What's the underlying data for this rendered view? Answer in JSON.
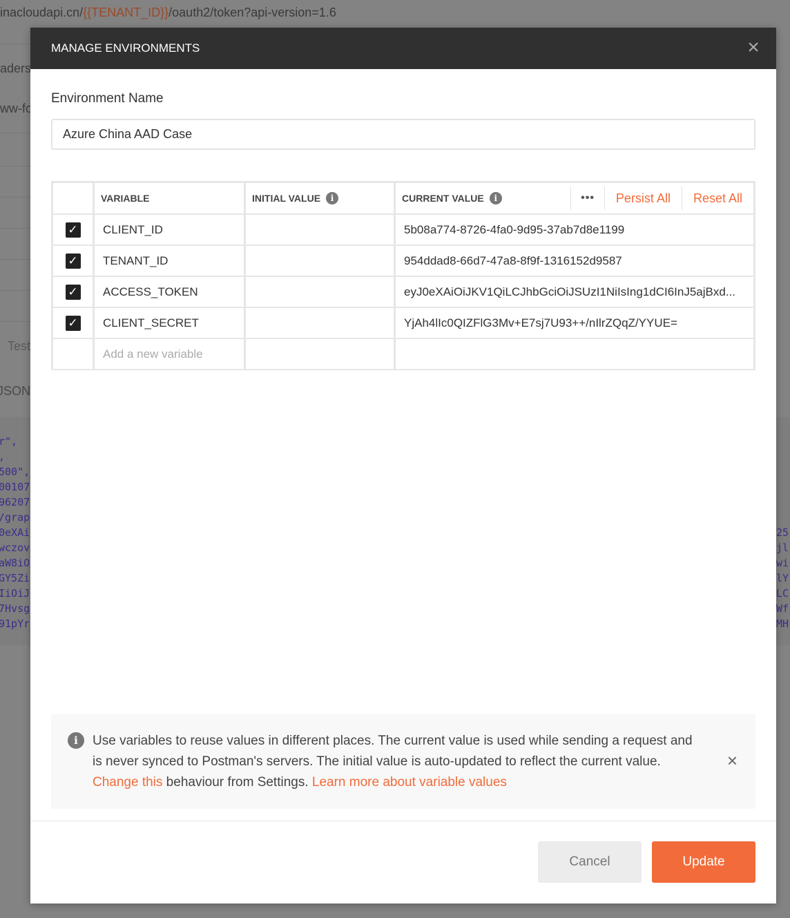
{
  "background": {
    "url_prefix": "inacloudapi.cn/",
    "url_var": "{{TENANT_ID}}",
    "url_suffix": "/oauth2/token?api-version=1.6",
    "tab_headers": "aders",
    "body_type": "ww-fo",
    "tests": "Test",
    "json": "JSON",
    "code_left": [
      "r\",",
      ",",
      "500\",",
      "00107",
      "96207",
      "/grap",
      "0eXAi",
      "wczov",
      "aW8iO",
      "GY5Zi",
      "IiOiJ",
      "7Hvsg",
      "91pYr"
    ],
    "code_right": [
      "25",
      "jl",
      "wi",
      "lY",
      "LC",
      "Wf",
      "MH"
    ]
  },
  "modal": {
    "title": "MANAGE ENVIRONMENTS",
    "env_name_label": "Environment Name",
    "env_name_value": "Azure China AAD Case",
    "table": {
      "headers": {
        "variable": "VARIABLE",
        "initial": "INITIAL VALUE",
        "current": "CURRENT VALUE",
        "more": "•••",
        "persist_all": "Persist All",
        "reset_all": "Reset All"
      },
      "rows": [
        {
          "checked": true,
          "variable": "CLIENT_ID",
          "initial": "",
          "current": "5b08a774-8726-4fa0-9d95-37ab7d8e1199"
        },
        {
          "checked": true,
          "variable": "TENANT_ID",
          "initial": "",
          "current": "954ddad8-66d7-47a8-8f9f-1316152d9587"
        },
        {
          "checked": true,
          "variable": "ACCESS_TOKEN",
          "initial": "",
          "current": "eyJ0eXAiOiJKV1QiLCJhbGciOiJSUzI1NiIsIng1dCI6InJ5ajBxd..."
        },
        {
          "checked": true,
          "variable": "CLIENT_SECRET",
          "initial": "",
          "current": "YjAh4lIc0QIZFlG3Mv+E7sj7U93++/nIlrZQqZ/YYUE="
        }
      ],
      "new_placeholder": "Add a new variable"
    },
    "notice": {
      "text1": "Use variables to reuse values in different places. The current value is used while sending a request and is never synced to Postman's servers. The initial value is auto-updated to reflect the current value. ",
      "link1": "Change this",
      "text2": " behaviour from Settings. ",
      "link2": "Learn more about variable values"
    },
    "cancel_label": "Cancel",
    "update_label": "Update"
  }
}
